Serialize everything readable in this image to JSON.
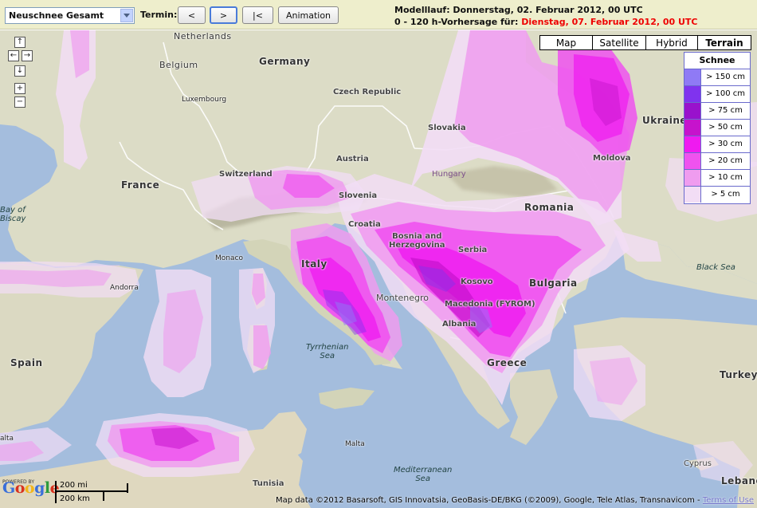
{
  "toolbar": {
    "product_select": {
      "value": "Neuschnee Gesamt"
    },
    "termin_label": "Termin:",
    "buttons": {
      "prev": "<",
      "next": ">",
      "first": "|<",
      "animation": "Animation"
    },
    "run_label": "Modelllauf: Donnerstag, 02. Februar 2012, 00 UTC",
    "forecast_prefix": "0 - 120 h-Vorhersage für: ",
    "forecast_date": "Dienstag, 07. Februar 2012, 00 UTC"
  },
  "map_types": [
    "Map",
    "Satellite",
    "Hybrid",
    "Terrain"
  ],
  "map_type_selected": "Terrain",
  "legend": {
    "title": "Schnee",
    "items": [
      {
        "label": "> 150 cm",
        "color": "#8f7af5"
      },
      {
        "label": "> 100 cm",
        "color": "#8033ee"
      },
      {
        "label": "> 75 cm",
        "color": "#9912cc"
      },
      {
        "label": "> 50 cm",
        "color": "#c613cc"
      },
      {
        "label": "> 30 cm",
        "color": "#ef1af0"
      },
      {
        "label": "> 20 cm",
        "color": "#ef52ef"
      },
      {
        "label": "> 10 cm",
        "color": "#ef9cef"
      },
      {
        "label": "> 5 cm",
        "color": "#f2ddf5"
      }
    ]
  },
  "labels": {
    "countries": {
      "netherlands": "Netherlands",
      "belgium": "Belgium",
      "germany": "Germany",
      "luxembourg": "Luxembourg",
      "czech": "Czech Republic",
      "france": "France",
      "switzerland": "Switzerland",
      "austria": "Austria",
      "slovakia": "Slovakia",
      "hungary": "Hungary",
      "ukraine": "Ukraine",
      "moldova": "Moldova",
      "slovenia": "Slovenia",
      "croatia": "Croatia",
      "romania": "Romania",
      "bosnia": "Bosnia and\nHerzegovina",
      "serbia": "Serbia",
      "italy": "Italy",
      "monaco": "Monaco",
      "kosovo": "Kosovo",
      "bulgaria": "Bulgaria",
      "montenegro": "Montenegro",
      "macedonia": "Macedonia (FYROM)",
      "albania": "Albania",
      "greece": "Greece",
      "spain": "Spain",
      "andorra": "Andorra",
      "turkey": "Turkey",
      "malta": "Malta",
      "tunisia": "Tunisia",
      "cyprus": "Cyprus",
      "lebanon": "Lebano",
      "malta_edge": "alta"
    },
    "seas": {
      "biscay": "Bay of\nBiscay",
      "tyrrhenian": "Tyrrhenian\nSea",
      "black": "Black Sea",
      "mediterranean": "Mediterranean\nSea"
    }
  },
  "nav": {
    "up": "↑",
    "left": "←",
    "right": "→",
    "down": "↓",
    "zoom_in": "+",
    "zoom_out": "−"
  },
  "footer": {
    "powered_by": "POWERED BY",
    "google": "Google",
    "scale_mi": "200 mi",
    "scale_km": "200 km",
    "map_data": "Map data ©2012 Basarsoft, GIS Innovatsia, GeoBasis-DE/BKG (©2009), Google, Tele Atlas, Transnavicom - ",
    "terms": "Terms of Use"
  }
}
